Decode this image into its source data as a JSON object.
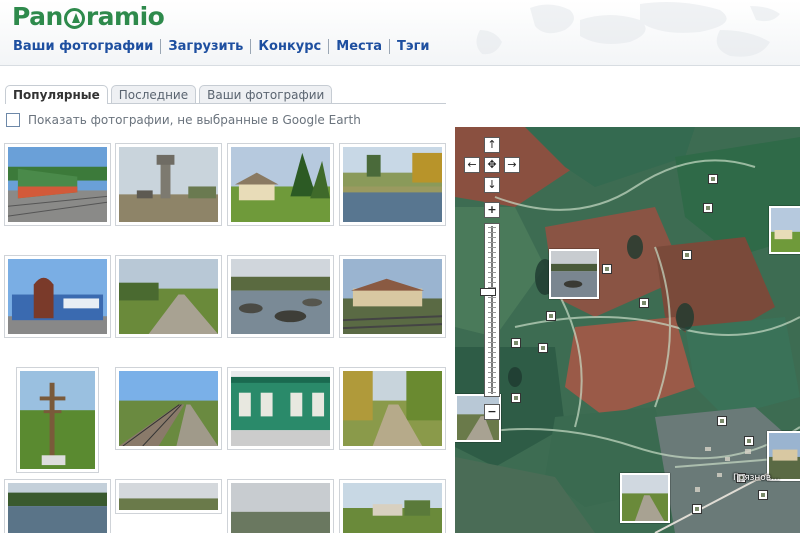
{
  "header": {
    "logo_text": "Panoramio",
    "nav": [
      "Ваши фотографии",
      "Загрузить",
      "Конкурс",
      "Места",
      "Тэги"
    ]
  },
  "tabs": [
    {
      "label": "Популярные",
      "active": true
    },
    {
      "label": "Последние",
      "active": false
    },
    {
      "label": "Ваши фотографии",
      "active": false
    }
  ],
  "filter": {
    "checkbox_label": "Показать фотографии, не выбранные в Google Earth",
    "checked": false
  },
  "map": {
    "place_label": "Грязнов...",
    "controls": {
      "up": "↑",
      "down": "↓",
      "left": "←",
      "right": "→",
      "center": "✥",
      "zoom_in": "+",
      "zoom_out": "−"
    }
  },
  "colors": {
    "brand": "#2e8a4c",
    "nav_link": "#1e4fa0"
  }
}
